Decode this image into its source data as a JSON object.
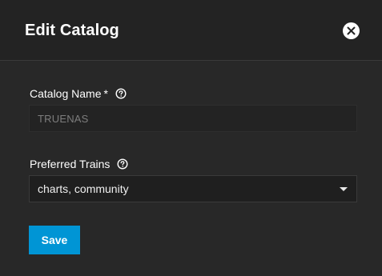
{
  "dialog": {
    "title": "Edit Catalog",
    "close_icon": "close-icon"
  },
  "form": {
    "catalog_name": {
      "label": "Catalog Name",
      "required_marker": "*",
      "value": "TRUENAS",
      "help_icon": "help-circle-icon",
      "disabled": true
    },
    "preferred_trains": {
      "label": "Preferred Trains",
      "value": "charts, community",
      "help_icon": "help-circle-icon"
    }
  },
  "actions": {
    "save_label": "Save"
  },
  "colors": {
    "background": "#282828",
    "header": "#232323",
    "accent": "#0095d5",
    "text": "#ffffff",
    "muted_text": "#7d7d7d"
  }
}
